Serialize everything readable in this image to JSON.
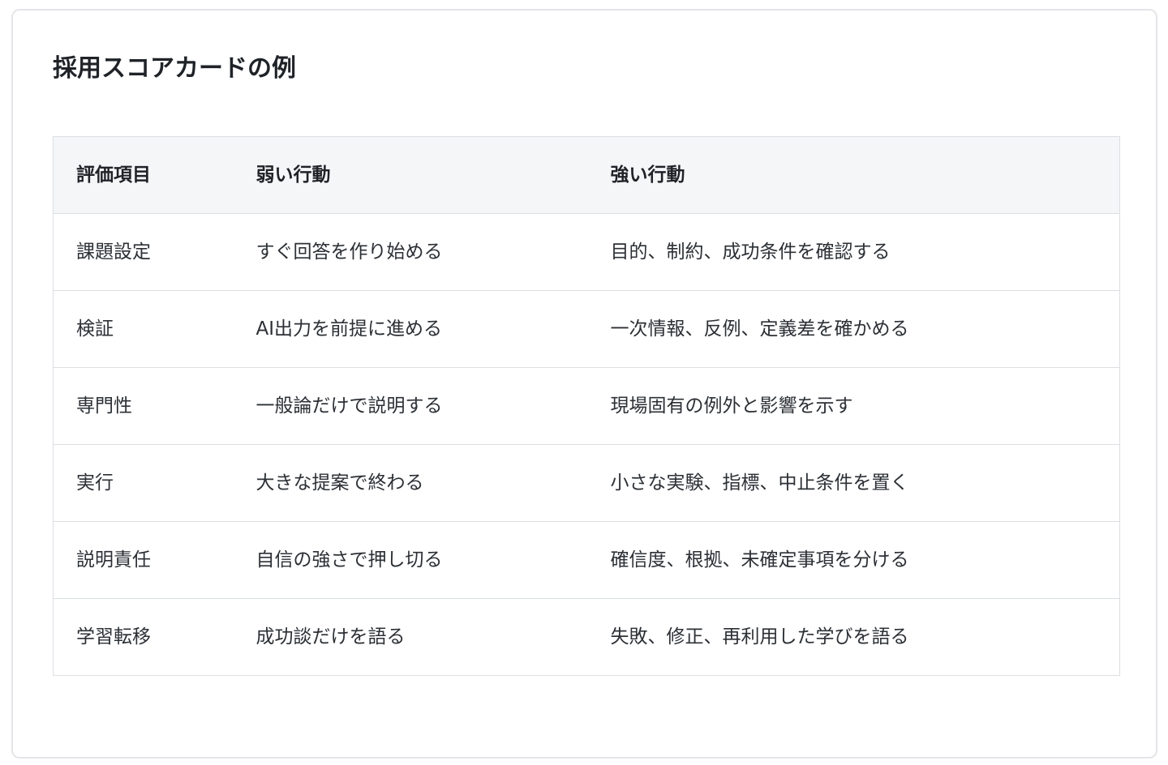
{
  "title": "採用スコアカードの例",
  "table": {
    "headers": [
      "評価項目",
      "弱い行動",
      "強い行動"
    ],
    "rows": [
      [
        "課題設定",
        "すぐ回答を作り始める",
        "目的、制約、成功条件を確認する"
      ],
      [
        "検証",
        "AI出力を前提に進める",
        "一次情報、反例、定義差を確かめる"
      ],
      [
        "専門性",
        "一般論だけで説明する",
        "現場固有の例外と影響を示す"
      ],
      [
        "実行",
        "大きな提案で終わる",
        "小さな実験、指標、中止条件を置く"
      ],
      [
        "説明責任",
        "自信の強さで押し切る",
        "確信度、根拠、未確定事項を分ける"
      ],
      [
        "学習転移",
        "成功談だけを語る",
        "失敗、修正、再利用した学びを語る"
      ]
    ]
  }
}
